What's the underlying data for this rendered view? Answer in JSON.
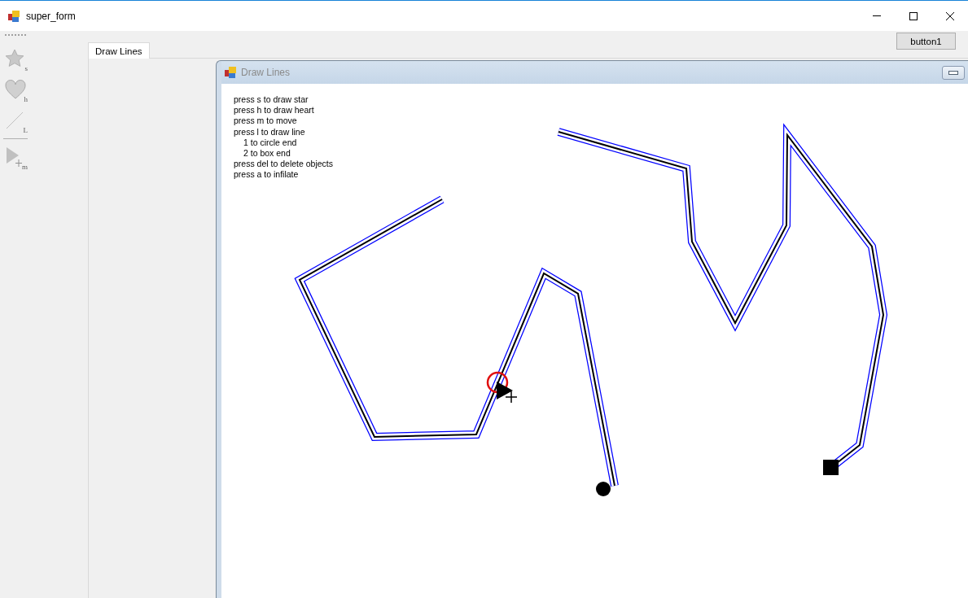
{
  "window": {
    "title": "super_form"
  },
  "tools": [
    {
      "kind": "star",
      "key": "s"
    },
    {
      "kind": "heart",
      "key": "h"
    },
    {
      "kind": "line",
      "key": "L"
    },
    {
      "kind": "move",
      "key": "m"
    }
  ],
  "tabs": [
    {
      "label": "Draw Lines",
      "selected": true
    }
  ],
  "button": "button1",
  "child_window": {
    "title": "Draw Lines"
  },
  "help_lines": [
    "press s to draw star",
    "press h to draw heart",
    "press m to move",
    "press l to draw line",
    "1 to circle end",
    "2 to box end",
    "press del to delete objects",
    "press a to infilate"
  ]
}
